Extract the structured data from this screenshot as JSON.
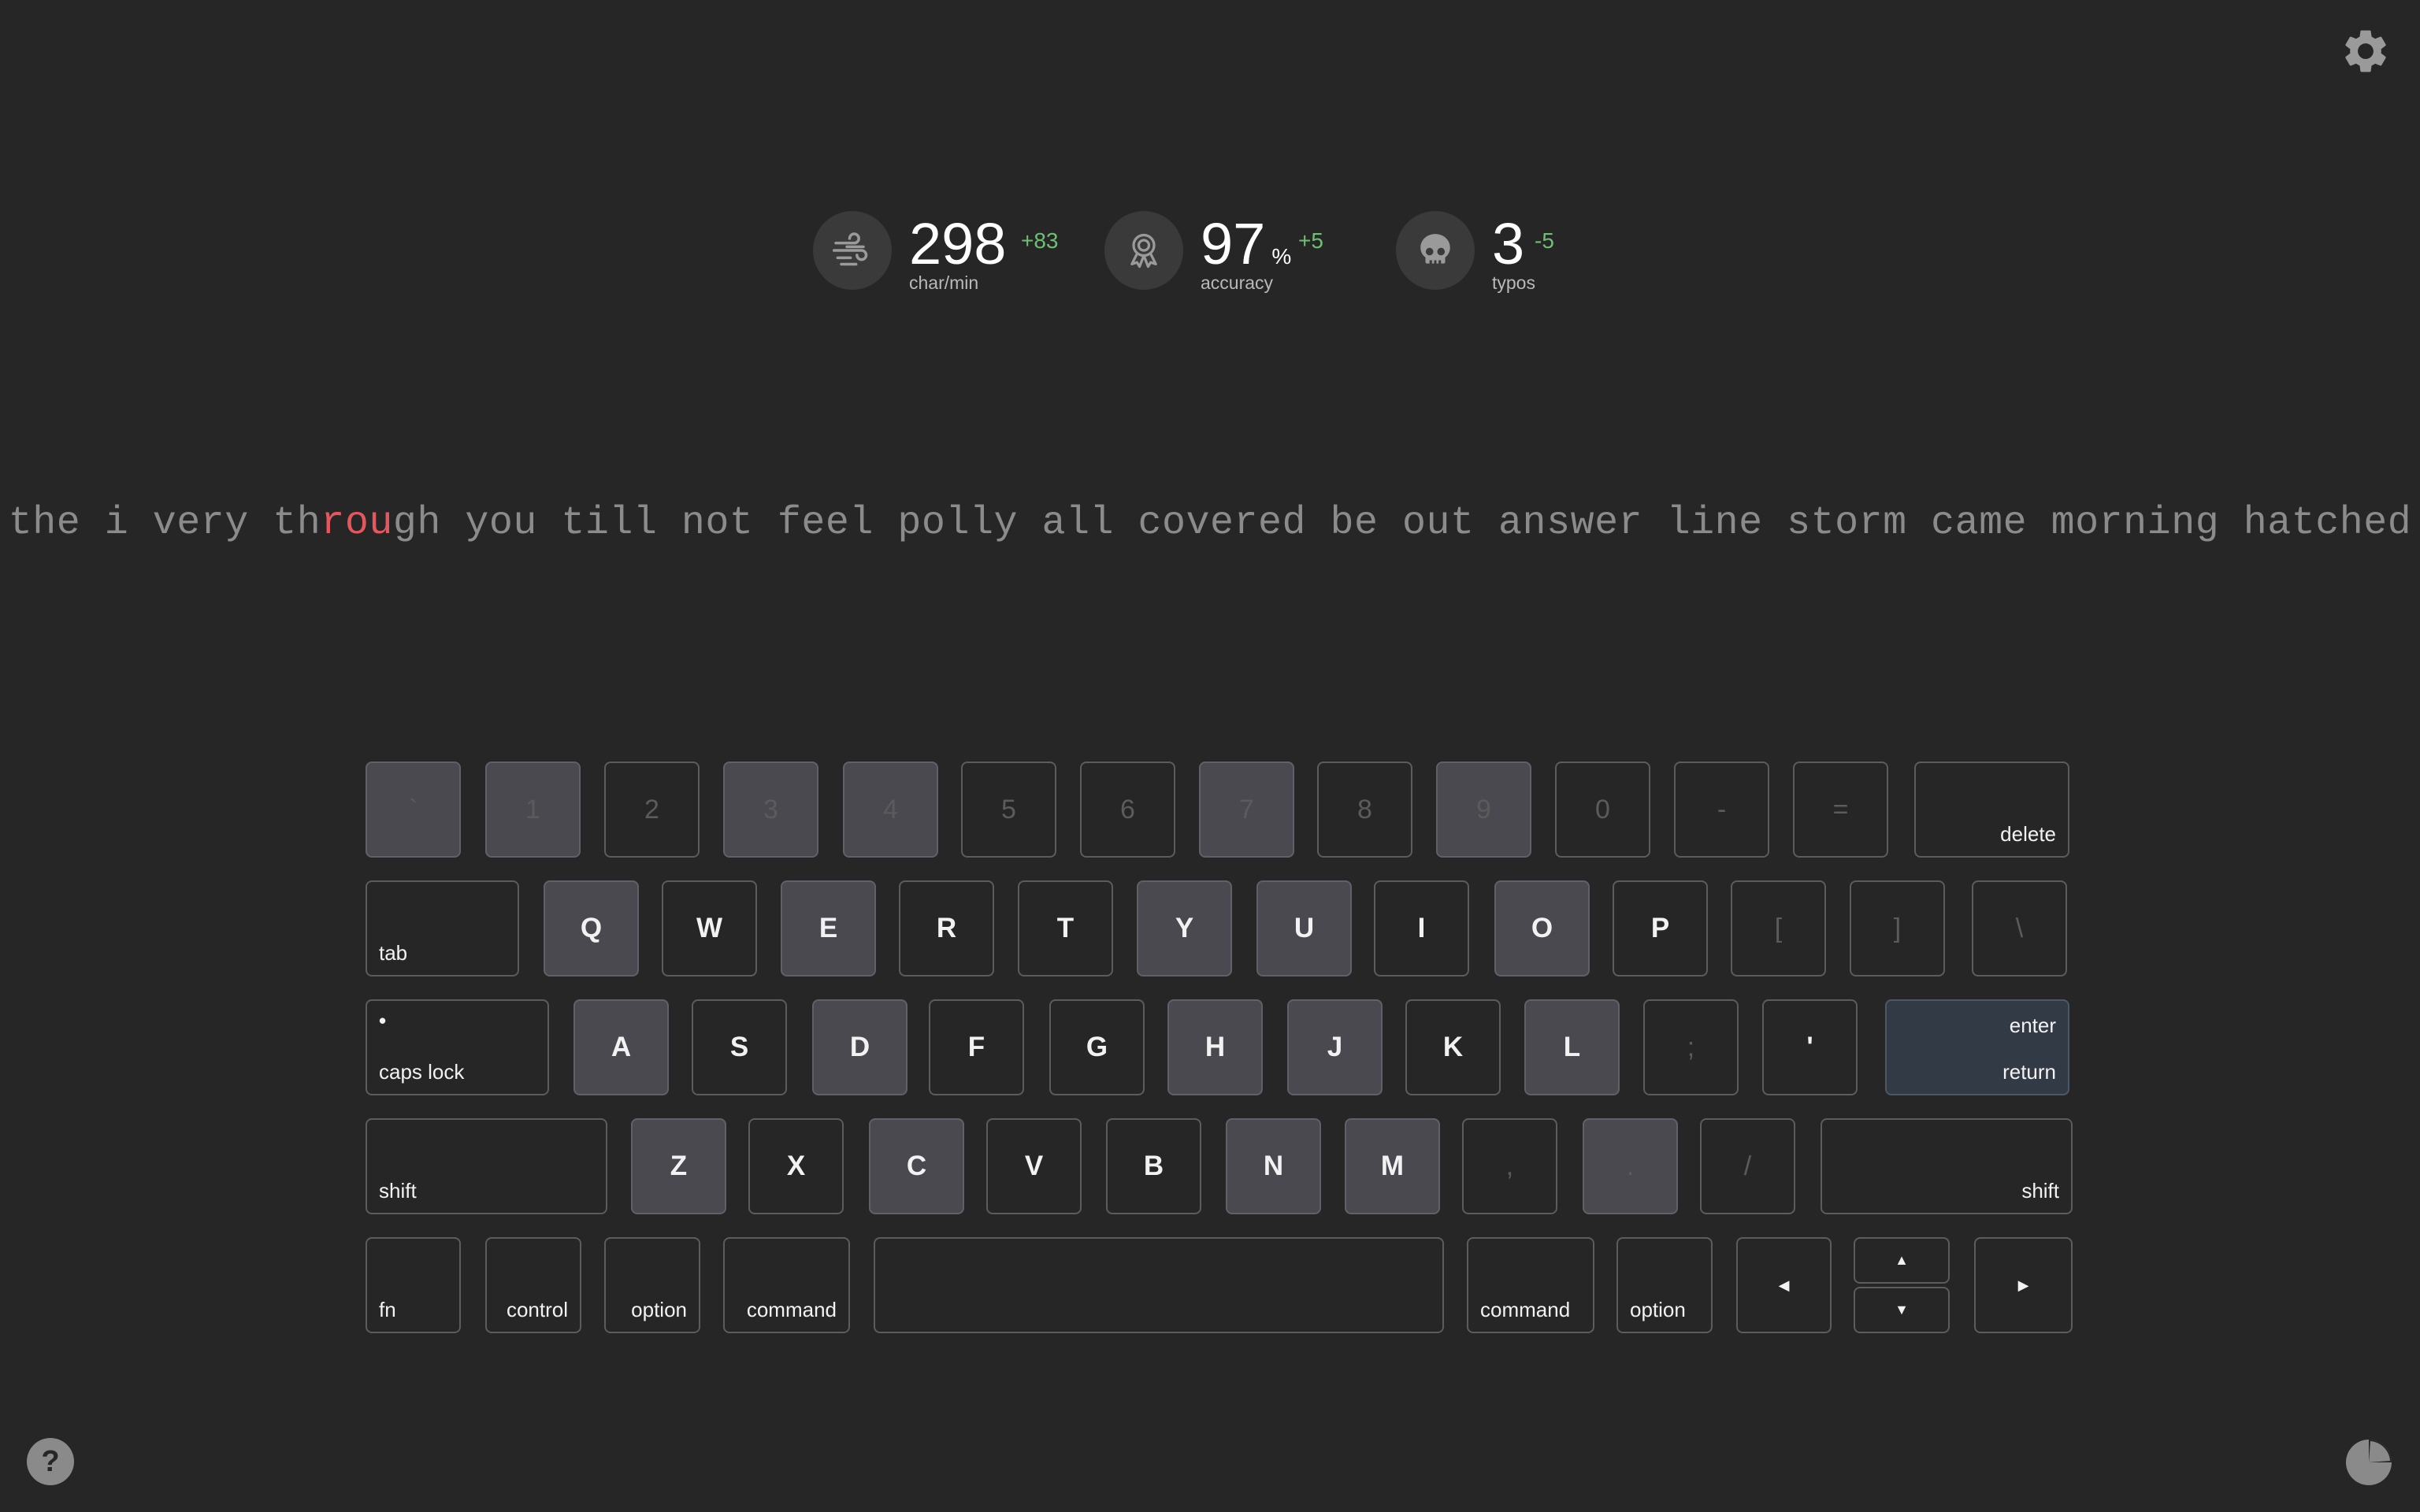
{
  "stats": {
    "speed": {
      "value": "298",
      "unit": "",
      "delta": "+83",
      "label": "char/min",
      "icon": "wind-icon"
    },
    "accuracy": {
      "value": "97",
      "unit": "%",
      "delta": "+5",
      "label": "accuracy",
      "icon": "award-ribbon-icon"
    },
    "typos": {
      "value": "3",
      "unit": "",
      "delta": "-5",
      "label": "typos",
      "icon": "skull-icon"
    }
  },
  "typing_text": {
    "before": "the i very th",
    "error": "rou",
    "after": "gh you till not feel polly all covered be out answer line storm came morning hatched"
  },
  "keyboard": {
    "row1": [
      {
        "c": "`",
        "hl": true,
        "dim": true
      },
      {
        "c": "1",
        "hl": true,
        "dim": true
      },
      {
        "c": "2",
        "hl": false,
        "dim": true
      },
      {
        "c": "3",
        "hl": true,
        "dim": true
      },
      {
        "c": "4",
        "hl": true,
        "dim": true
      },
      {
        "c": "5",
        "hl": false,
        "dim": true
      },
      {
        "c": "6",
        "hl": false,
        "dim": true
      },
      {
        "c": "7",
        "hl": true,
        "dim": true
      },
      {
        "c": "8",
        "hl": false,
        "dim": true
      },
      {
        "c": "9",
        "hl": true,
        "dim": true
      },
      {
        "c": "0",
        "hl": false,
        "dim": true
      },
      {
        "c": "-",
        "hl": false,
        "dim": true
      },
      {
        "c": "=",
        "hl": false,
        "dim": true
      }
    ],
    "delete_label": "delete",
    "tab_label": "tab",
    "row2": [
      {
        "c": "Q",
        "hl": true
      },
      {
        "c": "W",
        "hl": false
      },
      {
        "c": "E",
        "hl": true
      },
      {
        "c": "R",
        "hl": false
      },
      {
        "c": "T",
        "hl": false
      },
      {
        "c": "Y",
        "hl": true
      },
      {
        "c": "U",
        "hl": true
      },
      {
        "c": "I",
        "hl": false
      },
      {
        "c": "O",
        "hl": true
      },
      {
        "c": "P",
        "hl": false
      },
      {
        "c": "[",
        "hl": false,
        "dim": true
      },
      {
        "c": "]",
        "hl": false,
        "dim": true
      },
      {
        "c": "\\",
        "hl": false,
        "dim": true
      }
    ],
    "caps_dot": "•",
    "caps_label": "caps lock",
    "row3": [
      {
        "c": "A",
        "hl": true
      },
      {
        "c": "S",
        "hl": false
      },
      {
        "c": "D",
        "hl": true
      },
      {
        "c": "F",
        "hl": false
      },
      {
        "c": "G",
        "hl": false
      },
      {
        "c": "H",
        "hl": true
      },
      {
        "c": "J",
        "hl": true
      },
      {
        "c": "K",
        "hl": false
      },
      {
        "c": "L",
        "hl": true
      },
      {
        "c": ";",
        "hl": false,
        "dim": true
      },
      {
        "c": "'",
        "hl": false
      }
    ],
    "enter_label": "enter",
    "return_label": "return",
    "shift_label": "shift",
    "row4": [
      {
        "c": "Z",
        "hl": true
      },
      {
        "c": "X",
        "hl": false
      },
      {
        "c": "C",
        "hl": true
      },
      {
        "c": "V",
        "hl": false
      },
      {
        "c": "B",
        "hl": false
      },
      {
        "c": "N",
        "hl": true
      },
      {
        "c": "M",
        "hl": true
      },
      {
        "c": ",",
        "hl": false,
        "dim": true
      },
      {
        "c": ".",
        "hl": true,
        "dim": true
      },
      {
        "c": "/",
        "hl": false,
        "dim": true
      }
    ],
    "fn_label": "fn",
    "control_label": "control",
    "option_label": "option",
    "command_label": "command",
    "arrow_left": "◀",
    "arrow_up": "▲",
    "arrow_down": "▼",
    "arrow_right": "▶"
  },
  "colors": {
    "background": "#262626",
    "error": "#e5575c",
    "delta_positive": "#6fbf73",
    "highlight_key": "#4a4950"
  },
  "icons": {
    "settings": "gear-icon",
    "help": "question-mark-icon",
    "statistics": "pie-chart-icon"
  },
  "help": {
    "glyph": "?"
  }
}
